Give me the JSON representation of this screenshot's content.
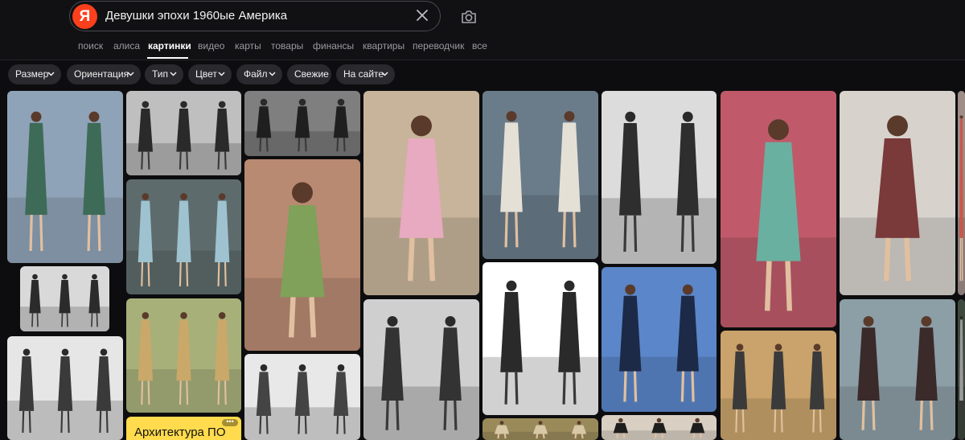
{
  "search": {
    "logo_letter": "Я",
    "query": "Девушки эпохи 1960ые Америка"
  },
  "icons": {
    "clear": "close-icon",
    "camera": "camera-search-icon",
    "chevron": "chevron-down-icon"
  },
  "tabs": [
    {
      "label": "поиск"
    },
    {
      "label": "алиса"
    },
    {
      "label": "картинки"
    },
    {
      "label": "видео"
    },
    {
      "label": "карты"
    },
    {
      "label": "товары"
    },
    {
      "label": "финансы"
    },
    {
      "label": "квартиры"
    },
    {
      "label": "переводчик"
    },
    {
      "label": "все"
    }
  ],
  "active_tab": "картинки",
  "filters": [
    {
      "label": "Размер",
      "dropdown": true
    },
    {
      "label": "Ориентация",
      "dropdown": true
    },
    {
      "label": "Тип",
      "dropdown": true
    },
    {
      "label": "Цвет",
      "dropdown": true
    },
    {
      "label": "Файл",
      "dropdown": true
    },
    {
      "label": "Свежие",
      "dropdown": false
    },
    {
      "label": "На сайте",
      "dropdown": true
    }
  ],
  "results": {
    "images": [
      {
        "bg": "#8fa3b8",
        "fg": "#3e6b57",
        "mono": false
      },
      {
        "bg": "#d9d9d9",
        "fg": "#2b2b2b",
        "mono": true
      },
      {
        "bg": "#e6e6e6",
        "fg": "#3a3a3a",
        "mono": true
      },
      {
        "bg": "#bfbfbf",
        "fg": "#2a2a2a",
        "mono": true
      },
      {
        "bg": "#5e6b6c",
        "fg": "#9ec2d0",
        "mono": false
      },
      {
        "bg": "#a8b07a",
        "fg": "#c9a86a",
        "mono": false
      },
      {
        "bg": "#7f7f7f",
        "fg": "#1f1f1f",
        "mono": true
      },
      {
        "bg": "#b98a72",
        "fg": "#7fa15a",
        "mono": false
      },
      {
        "bg": "#e8e8e8",
        "fg": "#444444",
        "mono": true
      },
      {
        "bg": "#c8b49a",
        "fg": "#e8aac0",
        "mono": false
      },
      {
        "bg": "#cfcfcf",
        "fg": "#333333",
        "mono": true
      },
      {
        "bg": "#6a7c8a",
        "fg": "#e5e0d6",
        "mono": false
      },
      {
        "bg": "#ffffff",
        "fg": "#2a2a2a",
        "mono": true
      },
      {
        "bg": "#9a8a5a",
        "fg": "#d8c8a6",
        "mono": false
      },
      {
        "bg": "#dcdcdc",
        "fg": "#2e2e2e",
        "mono": true
      },
      {
        "bg": "#5b86c9",
        "fg": "#1c2a48",
        "mono": false
      },
      {
        "bg": "#d9cfc2",
        "fg": "#1e1e1e",
        "mono": false
      },
      {
        "bg": "#c05a6a",
        "fg": "#6ab0a0",
        "mono": false
      },
      {
        "bg": "#c9a36b",
        "fg": "#3a3a3a",
        "mono": false
      },
      {
        "bg": "#d7d2cc",
        "fg": "#7a3a3a",
        "mono": false
      },
      {
        "bg": "#8c9ea6",
        "fg": "#3a2a2a",
        "mono": false
      },
      {
        "bg": "#9f8d87",
        "fg": "#c9574a",
        "mono": false
      },
      {
        "bg": "#3e4a3e",
        "fg": "#9a9a9a",
        "mono": true
      }
    ]
  },
  "ad": {
    "title": "Архитектура ПО",
    "more": "•••",
    "bg": "#ffdb4d"
  },
  "colors": {
    "accent": "#fc3f1d",
    "background": "#0d0d0f",
    "chip_bg": "#2a2a2e"
  }
}
